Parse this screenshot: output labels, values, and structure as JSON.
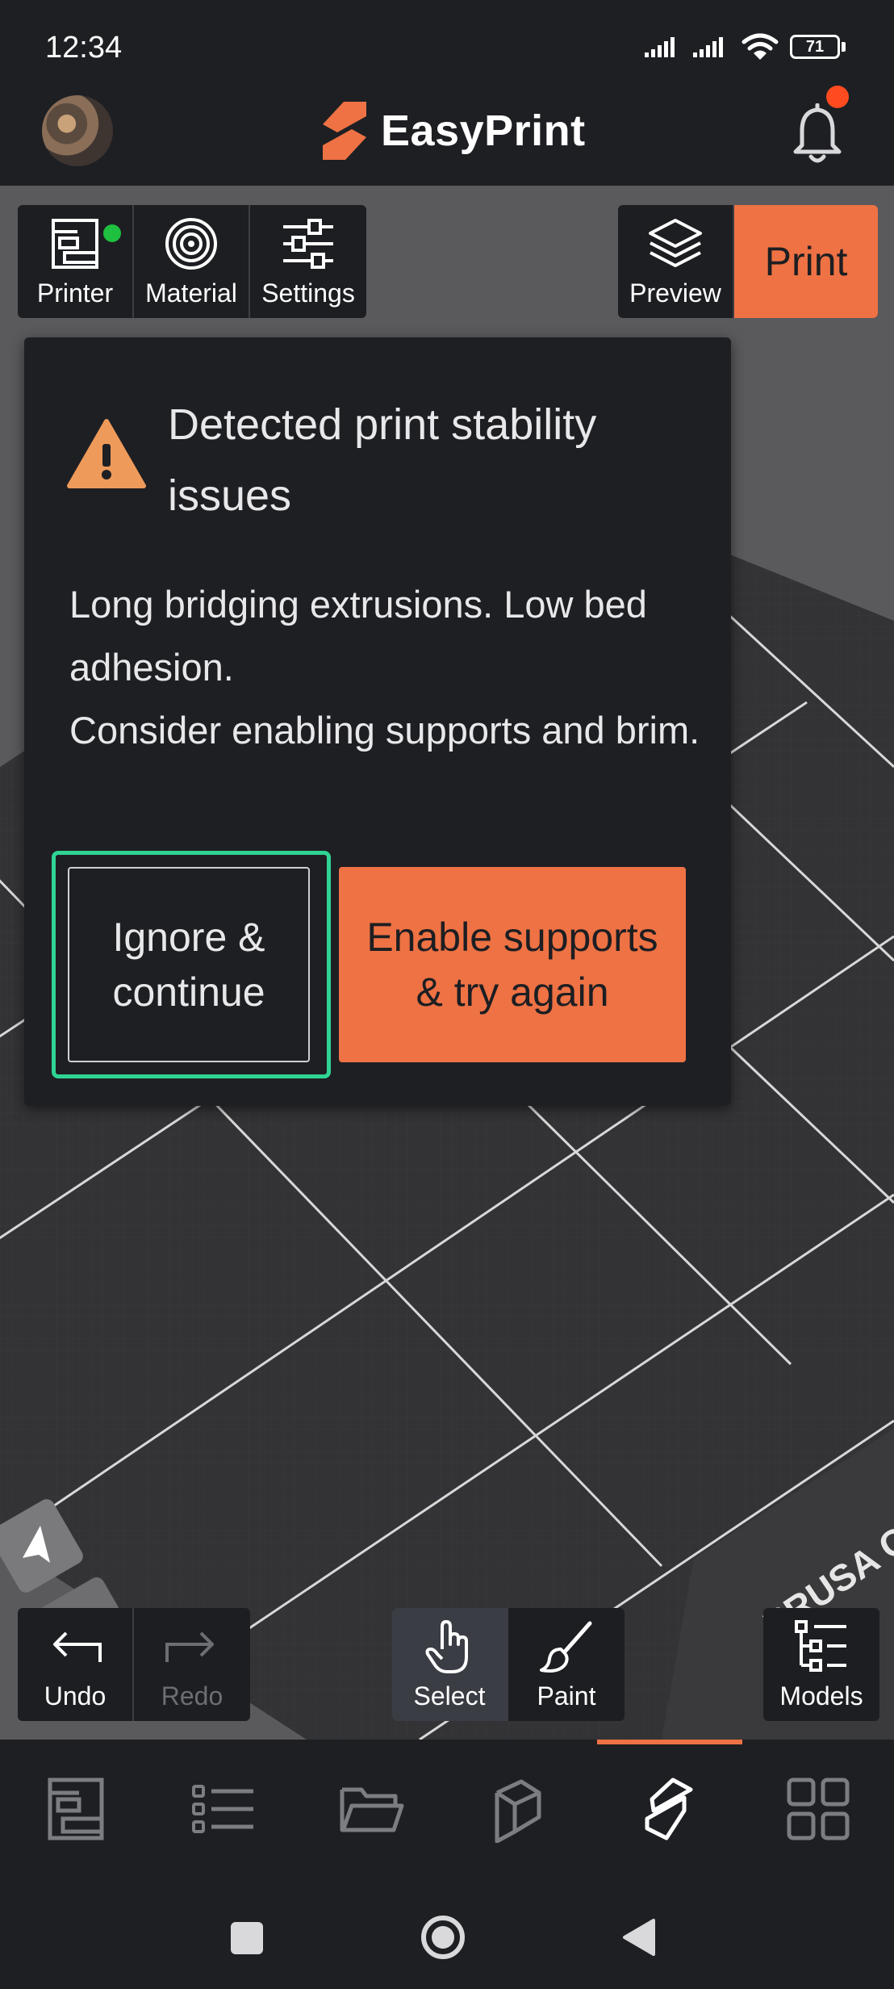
{
  "status_bar": {
    "time": "12:34",
    "battery": "71"
  },
  "header": {
    "app_name": "EasyPrint"
  },
  "toolbar_left": {
    "printer_label": "Printer",
    "material_label": "Material",
    "settings_label": "Settings"
  },
  "toolbar_right": {
    "preview_label": "Preview",
    "print_label": "Print"
  },
  "viewport": {
    "bed_brand": "PRUSA CO"
  },
  "dialog": {
    "title": "Detected print stability issues",
    "body_line1": "Long bridging extrusions. Low bed adhesion.",
    "body_line2": "Consider enabling supports and brim.",
    "ignore_label": "Ignore & continue",
    "enable_label": "Enable supports & try again"
  },
  "bottom_tools": {
    "undo_label": "Undo",
    "redo_label": "Redo",
    "select_label": "Select",
    "paint_label": "Paint",
    "models_label": "Models"
  },
  "bottom_nav": {
    "items": [
      "printer-icon",
      "list-icon",
      "folder-icon",
      "model-icon",
      "slicer-icon",
      "grid-icon"
    ],
    "active": "slicer-icon"
  },
  "colors": {
    "accent": "#ee7244",
    "focus": "#2fd493",
    "online": "#1fbf3f",
    "notification": "#ff4b1f"
  }
}
